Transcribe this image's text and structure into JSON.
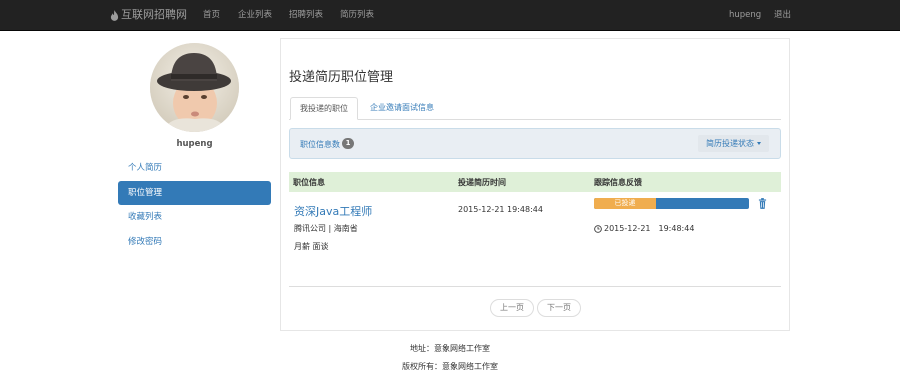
{
  "navbar": {
    "brand": "互联网招聘网",
    "links": [
      "首页",
      "企业列表",
      "招聘列表",
      "简历列表"
    ],
    "user": "hupeng",
    "logout": "退出"
  },
  "sidebar": {
    "username": "hupeng",
    "items": [
      {
        "label": "个人简历",
        "active": false
      },
      {
        "label": "职位管理",
        "active": true
      },
      {
        "label": "收藏列表",
        "active": false
      },
      {
        "label": "修改密码",
        "active": false
      }
    ]
  },
  "main": {
    "title": "投递简历职位管理",
    "tabs": [
      {
        "label": "我投递的职位",
        "active": true
      },
      {
        "label": "企业邀请面试信息",
        "active": false
      }
    ],
    "info_bar": {
      "label": "职位信息数",
      "count": "1",
      "filter_label": "简历投递状态"
    },
    "table": {
      "headers": [
        "职位信息",
        "投递简历时间",
        "跟踪信息反馈"
      ],
      "rows": [
        {
          "title": "资深Java工程师",
          "company_location": "腾讯公司 | 海南省",
          "salary": "月薪 面谈",
          "apply_time": "2015-12-21 19:48:44",
          "status": "已投递",
          "status_progress_percent": 40,
          "feedback_time": "2015-12-21　19:48:44"
        }
      ]
    },
    "pagination": {
      "prev": "上一页",
      "next": "下一页"
    }
  },
  "footer": {
    "address": "地址：意象网络工作室",
    "copyright": "版权所有：意象网络工作室"
  },
  "colors": {
    "navbar_bg": "#222222",
    "primary": "#337ab7",
    "warning": "#f0ad4e",
    "table_header_bg": "#dff0d8",
    "info_bar_bg": "#e9eef3"
  }
}
